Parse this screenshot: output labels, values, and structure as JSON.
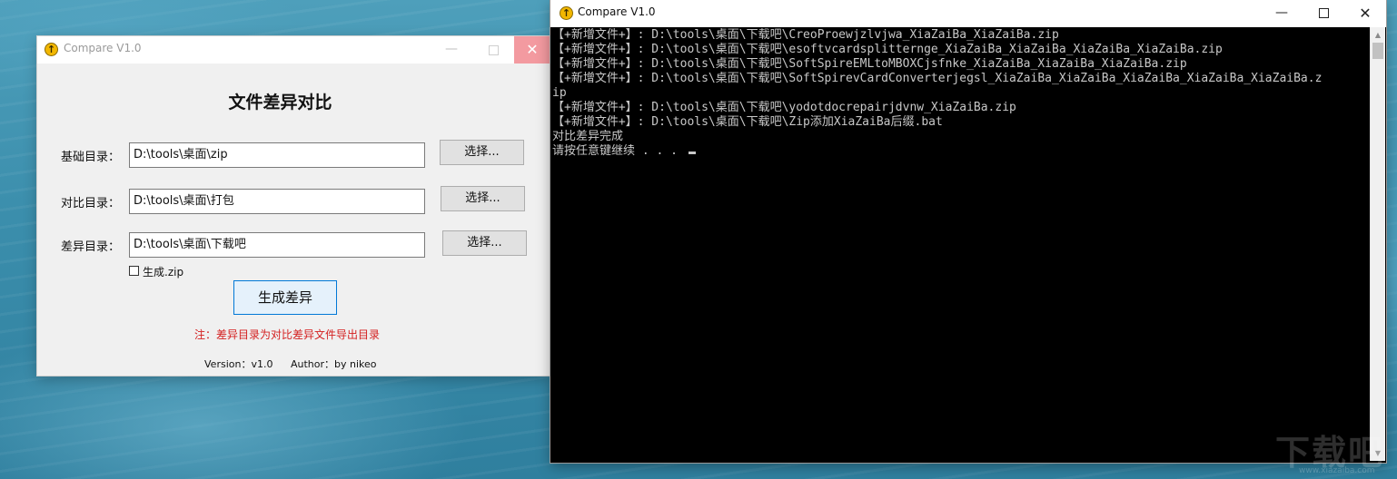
{
  "gui_window": {
    "title": "Compare V1.0",
    "heading": "文件差异对比",
    "base_dir": {
      "label": "基础目录：",
      "value": "D:\\tools\\桌面\\zip",
      "button": "选择..."
    },
    "compare_dir": {
      "label": "对比目录：",
      "value": "D:\\tools\\桌面\\打包",
      "button": "选择..."
    },
    "diff_dir": {
      "label": "差异目录：",
      "value": "D:\\tools\\桌面\\下载吧",
      "button": "选择..."
    },
    "zip_checkbox": {
      "label": "生成.zip",
      "checked": false
    },
    "generate_button": "生成差异",
    "note": "注：差异目录为对比差异文件导出目录",
    "version": "Version：v1.0",
    "author": "Author：by nikeo",
    "close_color": "#f39aa0"
  },
  "console_window": {
    "title": "Compare V1.0",
    "lines": [
      "【+新增文件+】: D:\\tools\\桌面\\下载吧\\CreoProewjzlvjwa_XiaZaiBa_XiaZaiBa.zip",
      "【+新增文件+】: D:\\tools\\桌面\\下载吧\\esoftvcardsplitternge_XiaZaiBa_XiaZaiBa_XiaZaiBa_XiaZaiBa.zip",
      "【+新增文件+】: D:\\tools\\桌面\\下载吧\\SoftSpireEMLtoMBOXCjsfnke_XiaZaiBa_XiaZaiBa_XiaZaiBa.zip",
      "【+新增文件+】: D:\\tools\\桌面\\下载吧\\SoftSpirevCardConverterjegsl_XiaZaiBa_XiaZaiBa_XiaZaiBa_XiaZaiBa_XiaZaiBa.z",
      "ip",
      "【+新增文件+】: D:\\tools\\桌面\\下载吧\\yodotdocrepairjdvnw_XiaZaiBa.zip",
      "【+新增文件+】: D:\\tools\\桌面\\下载吧\\Zip添加XiaZaiBa后缀.bat",
      "对比差异完成",
      "请按任意键继续 . . . "
    ]
  },
  "watermark": {
    "text": "下载吧",
    "url": "www.xiazaiba.com"
  }
}
